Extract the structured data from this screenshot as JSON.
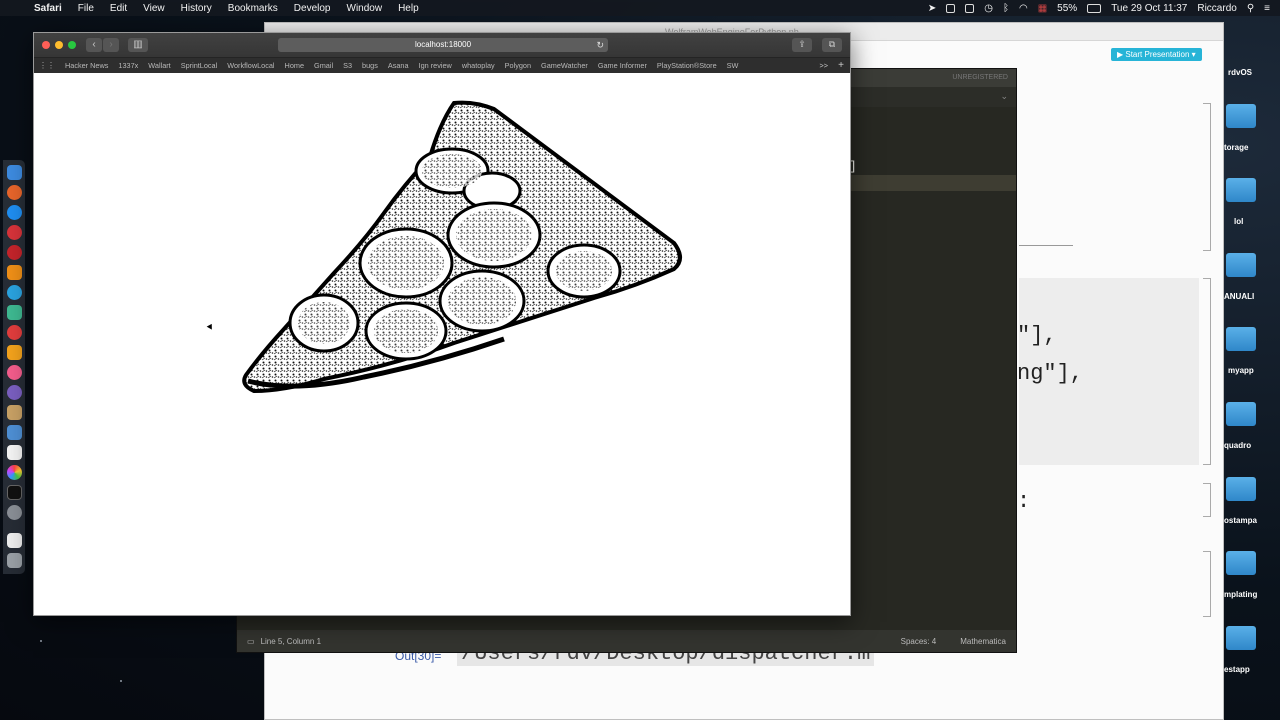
{
  "menubar": {
    "app_name": "Safari",
    "items": [
      "File",
      "Edit",
      "View",
      "History",
      "Bookmarks",
      "Develop",
      "Window",
      "Help"
    ],
    "battery": "55%",
    "datetime": "Tue 29 Oct  11:37",
    "user": "Riccardo"
  },
  "safari": {
    "url": "localhost:18000",
    "bookmarks": [
      "Hacker News",
      "1337x",
      "Wallart",
      "SprintLocal",
      "WorkflowLocal",
      "Home",
      "Gmail",
      "S3",
      "bugs",
      "Asana",
      "Ign review",
      "whatoplay",
      "Polygon",
      "GameWatcher",
      "Game Informer",
      "PlayStation®Store",
      "SW"
    ],
    "bookmarks_more": ">>",
    "image_subject": "pepperoni pizza slice edge-detection sketch"
  },
  "editor": {
    "line_col": "Line 5, Column 1",
    "spaces": "Spaces: 4",
    "syntax": "Mathematica",
    "top_label": "UNREGISTERED",
    "bracket": "]"
  },
  "background_doc": {
    "title": "WolframWebEngineForPython.nb",
    "start_presentation": "Start Presentation",
    "code_line_1": "\"],",
    "code_line_2": "ng\"],",
    "code_line_3": ":",
    "out_label": "Out[30]=",
    "out_value": "/Users/rdv/Desktop/dispatcher.m"
  },
  "desktop_icons": [
    "rdvOS",
    "torage",
    "lol",
    "ANUALI",
    "myapp",
    "quadro",
    "ostampa",
    "mplating",
    "estapp"
  ],
  "colors": {
    "accent": "#27b4d7",
    "editor_bg": "#272822",
    "safari_toolbar": "#3a3a3a"
  }
}
